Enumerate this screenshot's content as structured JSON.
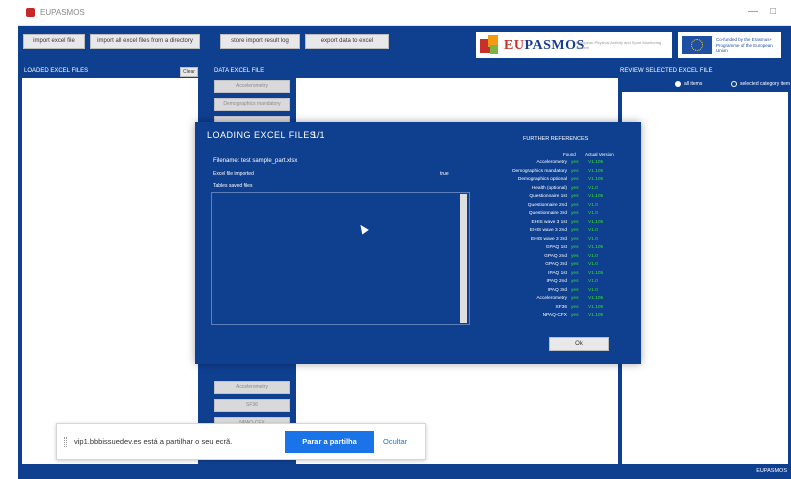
{
  "window": {
    "app_title": "EUPASMOS",
    "controls": [
      "—",
      "□"
    ]
  },
  "toolbar": {
    "buttons": [
      "import excel file",
      "import all excel files from a directory",
      "store import result log",
      "export data to excel"
    ]
  },
  "logo": {
    "name_part1": "EU",
    "name_part2": "PASMOS",
    "subtitle": "European Physical Activity and Sport Monitoring System"
  },
  "eu_logo": {
    "text": "Co-funded by the Erasmus+ Programme of the European Union"
  },
  "panels": {
    "loaded_label": "LOADED EXCEL FILES",
    "delete_label": "Clear",
    "data_label": "DATA EXCEL FILE",
    "view_label": "REVIEW SELECTED EXCEL FILE",
    "data_buttons_top": [
      "Accelerometry",
      "Demographics mandatory"
    ],
    "data_buttons_bottom": [
      "Accelerometry",
      "SF36",
      "NPAQ-CFX"
    ]
  },
  "view_options": {
    "option1": "all items",
    "option2": "selected category item"
  },
  "modal": {
    "title": "LOADING EXCEL FILES",
    "counter": "1/1",
    "file_label": "Filename: test sample_part.xlsx",
    "row1_label": "Excel file imported",
    "row1_value": "true",
    "row2_label": "Tables saved files",
    "ref_title": "FURTHER REFERENCES",
    "col_found": "Found",
    "col_version": "Actual Version",
    "refs": [
      {
        "name": "Accelerometry",
        "found": "yes",
        "version": "V1.105"
      },
      {
        "name": "Demographics mandatory",
        "found": "yes",
        "version": "V1.105"
      },
      {
        "name": "Demographics optional",
        "found": "yes",
        "version": "V1.105"
      },
      {
        "name": "Health (optional)",
        "found": "yes",
        "version": "V1.0"
      },
      {
        "name": "Questionnaire 1st",
        "found": "yes",
        "version": "V1.105"
      },
      {
        "name": "Questionnaire 2nd",
        "found": "yes",
        "version": "V1.0"
      },
      {
        "name": "Questionnaire 3rd",
        "found": "yes",
        "version": "V1.0"
      },
      {
        "name": "EHIS wave 3 1st",
        "found": "yes",
        "version": "V1.105"
      },
      {
        "name": "EHIS wave 3 2nd",
        "found": "yes",
        "version": "V1.0"
      },
      {
        "name": "EHIS wave 3 3rd",
        "found": "yes",
        "version": "V1.0"
      },
      {
        "name": "GPAQ 1st",
        "found": "yes",
        "version": "V1.105"
      },
      {
        "name": "GPAQ 2nd",
        "found": "yes",
        "version": "V1.0"
      },
      {
        "name": "GPAQ 3rd",
        "found": "yes",
        "version": "V1.0"
      },
      {
        "name": "IPAQ 1st",
        "found": "yes",
        "version": "V1.105"
      },
      {
        "name": "IPAQ 2nd",
        "found": "yes",
        "version": "V1.0"
      },
      {
        "name": "IPAQ 3rd",
        "found": "yes",
        "version": "V1.0"
      },
      {
        "name": "Accelerometry",
        "found": "yes",
        "version": "V1.105"
      },
      {
        "name": "SF36",
        "found": "yes",
        "version": "V1.105"
      },
      {
        "name": "NPAQ-CFX",
        "found": "yes",
        "version": "V1.105"
      }
    ],
    "ok_label": "Ok"
  },
  "share_bar": {
    "message": "vip1.bbbissuedev.es está a partilhar o seu ecrã.",
    "stop_label": "Parar a partilha",
    "hide_label": "Ocultar"
  },
  "status": {
    "version": "EUPASMOS"
  }
}
